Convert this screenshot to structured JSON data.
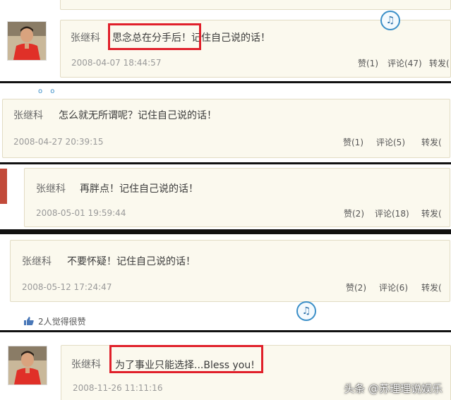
{
  "posts": [
    {
      "name": "张继科",
      "message_highlight": "思念总在分手后！",
      "message_rest": "记住自己说的话！",
      "date": "2008-04-07 18:44:57",
      "actions": [
        "赞(1)",
        "评论(47)",
        "转发("
      ]
    },
    {
      "name": "张继科",
      "message": "怎么就无所谓呢？记住自己说的话！",
      "date": "2008-04-27 20:39:15",
      "actions": [
        "赞(1)",
        "评论(5)",
        "转发("
      ]
    },
    {
      "name": "张继科",
      "message": "再胖点！记住自己说的话！",
      "date": "2008-05-01 19:59:44",
      "actions": [
        "赞(2)",
        "评论(18)",
        "转发("
      ]
    },
    {
      "name": "张继科",
      "message": "不要怀疑！记住自己说的话！",
      "date": "2008-05-12 17:24:47",
      "actions": [
        "赞(2)",
        "评论(6)",
        "转发("
      ],
      "likes_text": "2人觉得很赞"
    },
    {
      "name": "张继科",
      "message_highlight": "为了事业只能选择...Bless you!",
      "date": "2008-11-26 11:11:16"
    }
  ],
  "watermark": "头条 @苏理理说娱乐",
  "colors": {
    "highlight": "#e0202a",
    "card_bg": "#fbf9ee",
    "link": "#3b8fc8"
  },
  "icons": [
    "avatar-photo",
    "weibo-logo-icon",
    "thumbs-up-icon"
  ]
}
